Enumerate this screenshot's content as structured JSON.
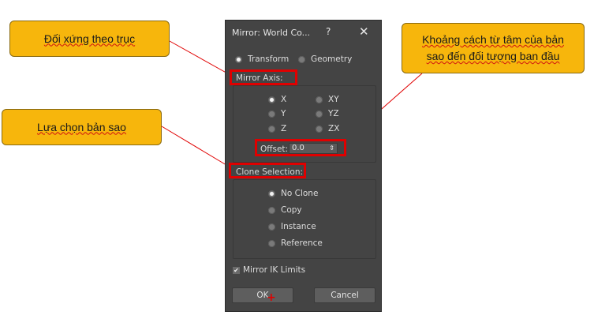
{
  "dialog": {
    "title": "Mirror: World Co...",
    "help_glyph": "?",
    "close_glyph": "✕",
    "mode": {
      "options": [
        {
          "label": "Transform",
          "selected": true
        },
        {
          "label": "Geometry",
          "selected": false
        }
      ]
    },
    "mirror_axis": {
      "label": "Mirror Axis:",
      "options": [
        {
          "label": "X",
          "selected": true
        },
        {
          "label": "Y",
          "selected": false
        },
        {
          "label": "Z",
          "selected": false
        },
        {
          "label": "XY",
          "selected": false
        },
        {
          "label": "YZ",
          "selected": false
        },
        {
          "label": "ZX",
          "selected": false
        }
      ],
      "offset_label": "Offset:",
      "offset_value": "0.0",
      "spinner_glyph": "⇕"
    },
    "clone_selection": {
      "label": "Clone Selection:",
      "options": [
        {
          "label": "No Clone",
          "selected": true
        },
        {
          "label": "Copy",
          "selected": false
        },
        {
          "label": "Instance",
          "selected": false
        },
        {
          "label": "Reference",
          "selected": false
        }
      ]
    },
    "mirror_ik_limits": {
      "label": "Mirror IK Limits",
      "checked": true,
      "check_glyph": "✔"
    },
    "ok_label": "OK",
    "cancel_label": "Cancel"
  },
  "callouts": {
    "mirror_axis": "Đối xứng theo trục",
    "clone_selection": "Lựa chọn bản sao",
    "offset_line1": "Khoảng cách từ tâm của bản",
    "offset_line2": "sao đến đối tượng ban đầu"
  },
  "plus_glyph": "+",
  "colors": {
    "dialog_bg": "#444444",
    "callout_bg": "#f7b60c",
    "highlight": "#e00000"
  }
}
